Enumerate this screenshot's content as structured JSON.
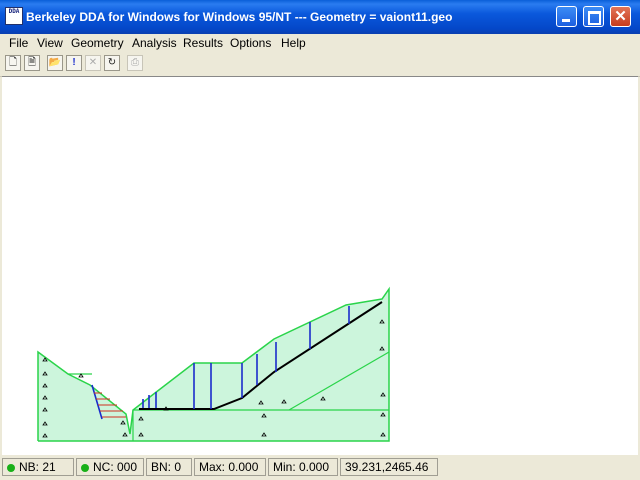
{
  "window": {
    "title": "Berkeley DDA for Windows for Windows 95/NT  ---  Geometry = vaiont11.geo",
    "icon_text": "DDA",
    "controls": [
      "minimize-icon",
      "maximize-icon",
      "close-icon"
    ]
  },
  "menu": [
    "File",
    "View",
    "Geometry",
    "Analysis",
    "Results",
    "Options",
    "Help"
  ],
  "toolbar": {
    "icons": [
      "new-file-icon",
      "new-document-icon",
      "open-folder-icon",
      "exclamation-icon",
      "cross-icon",
      "refresh-icon",
      "print-icon"
    ],
    "glyphs": [
      "🗋",
      "🗎",
      "📂",
      "!",
      "✕",
      "↻",
      "⎙"
    ]
  },
  "status": {
    "nb": "NB: 21",
    "nc": "NC: 000",
    "bn": "BN: 0",
    "max": "Max: 0.000",
    "min": "Min: 0.000",
    "coords": "39.231,2465.46"
  },
  "colors": {
    "fill": "#ccf5dc",
    "outline": "#2ad44a",
    "joint": "#1a2ccc",
    "sliding_surface": "#000000",
    "hatch": "#d03020"
  }
}
